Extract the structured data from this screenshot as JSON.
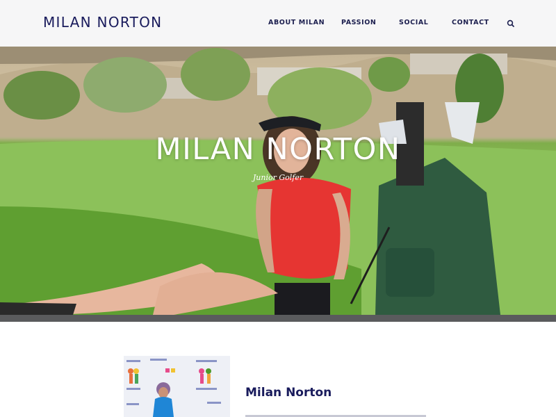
{
  "header": {
    "brand": "MILAN NORTON",
    "nav": [
      {
        "label": "ABOUT MILAN"
      },
      {
        "label": "PASSION"
      },
      {
        "label": "SOCIAL"
      },
      {
        "label": "CONTACT"
      }
    ],
    "search_icon": "search-icon"
  },
  "hero": {
    "title": "MILAN NORTON",
    "subtitle": "Junior Golfer"
  },
  "profile": {
    "name": "Milan Norton"
  },
  "colors": {
    "brand_navy": "#191b5c",
    "header_bg": "#f6f6f7",
    "hero_bar": "#5a5b5d"
  }
}
